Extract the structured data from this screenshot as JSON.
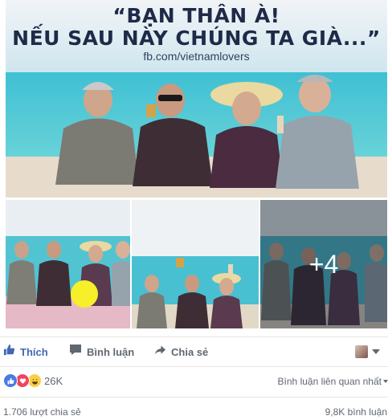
{
  "post": {
    "main_photo": {
      "caption_line1": "“BẠN THÂN À!",
      "caption_line2": "NẾU SAU NÀY CHÚNG TA GIÀ...”",
      "source": "fb.com/vietnamlovers"
    },
    "more_photos_label": "+4"
  },
  "actions": {
    "like_label": "Thích",
    "comment_label": "Bình luận",
    "share_label": "Chia sẻ"
  },
  "reactions": {
    "count": "26K",
    "sort_label": "Bình luận liên quan nhất"
  },
  "stats": {
    "shares": "1.706 lượt chia sẻ",
    "comments": "9,8K bình luận"
  },
  "colors": {
    "like_blue": "#4267b2",
    "muted_text": "#606770"
  },
  "icons": [
    "like-icon",
    "comment-icon",
    "share-icon",
    "like-reaction-icon",
    "love-reaction-icon",
    "haha-reaction-icon"
  ]
}
